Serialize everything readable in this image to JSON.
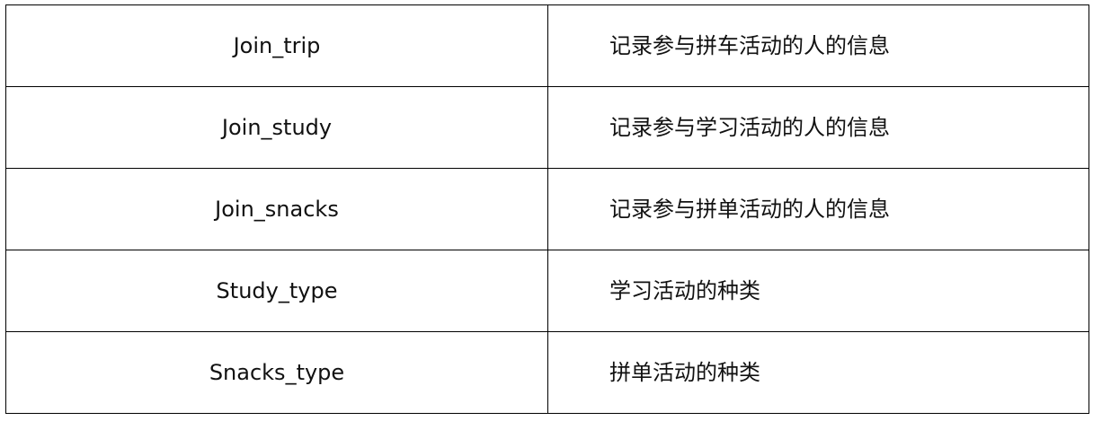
{
  "table": {
    "rows": [
      {
        "name": "Join_trip",
        "description": "记录参与拼车活动的人的信息"
      },
      {
        "name": "Join_study",
        "description": "记录参与学习活动的人的信息"
      },
      {
        "name": "Join_snacks",
        "description": "记录参与拼单活动的人的信息"
      },
      {
        "name": "Study_type",
        "description": "学习活动的种类"
      },
      {
        "name": "Snacks_type",
        "description": "拼单活动的种类"
      }
    ]
  }
}
